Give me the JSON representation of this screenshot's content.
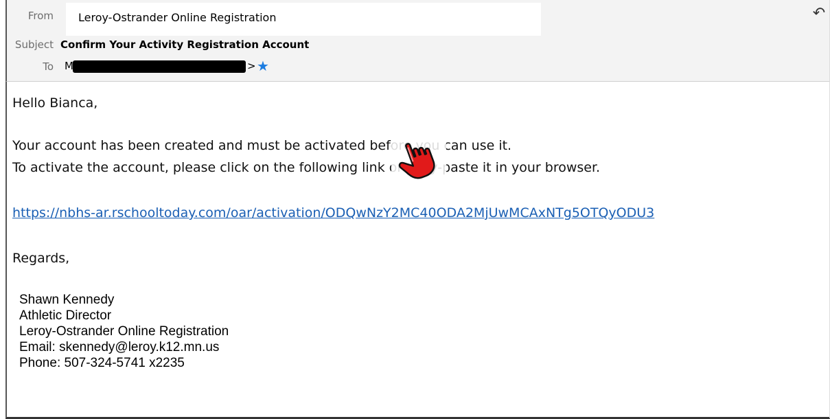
{
  "header": {
    "from_label": "From",
    "from_value": "Leroy-Ostrander Online Registration",
    "subject_label": "Subject",
    "subject_value": "Confirm Your Activity Registration Account",
    "to_label": "To",
    "to_prefix": "M",
    "to_suffix": ">",
    "reply_icon": "reply-icon",
    "star_icon": "star-icon"
  },
  "body": {
    "greeting": "Hello Bianca,",
    "line1": "Your account has been created and must be activated before you can use it.",
    "line2": "To activate the account, please click on the following link or copy-paste it in your browser.",
    "link": "https://nbhs-ar.rschooltoday.com/oar/activation/ODQwNzY2MC40ODA2MjUwMCAxNTg5OTQyODU3",
    "regards": "Regards,"
  },
  "signature": {
    "name": "Shawn Kennedy",
    "title": "Athletic Director",
    "org": "Leroy-Ostrander Online Registration",
    "email": "Email: skennedy@leroy.k12.mn.us",
    "phone": "Phone: 507-324-5741 x2235"
  },
  "colors": {
    "link": "#1a5fb4",
    "star": "#1c7ce0",
    "cursor": "#e11a1a"
  }
}
